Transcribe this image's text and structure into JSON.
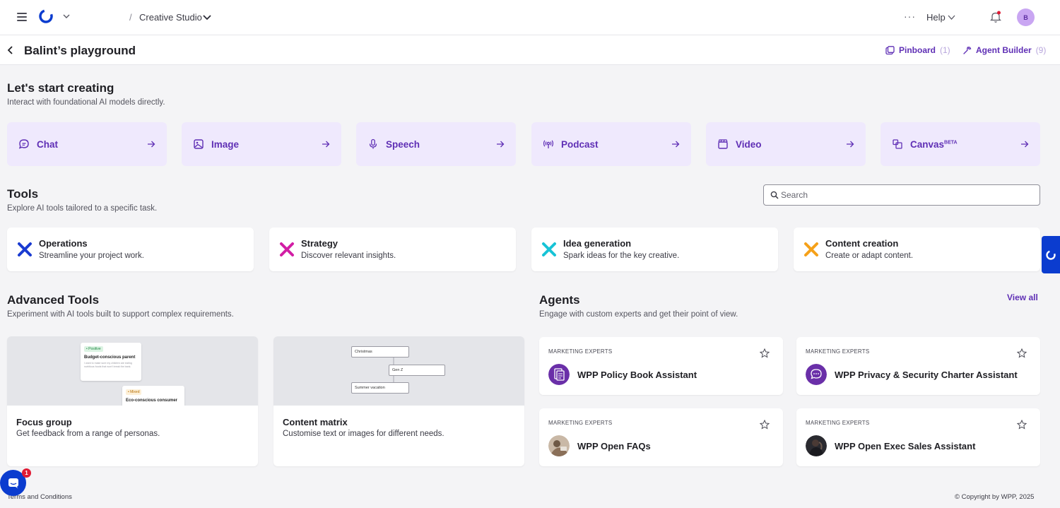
{
  "topnav": {
    "breadcrumb_separator": "/",
    "workspace": "Creative Studio",
    "more": "···",
    "help": "Help",
    "avatar_initial": "B"
  },
  "header": {
    "title": "Balint’s playground",
    "pinboard_label": "Pinboard",
    "pinboard_count": "(1)",
    "agent_builder_label": "Agent Builder",
    "agent_builder_count": "(9)"
  },
  "create": {
    "heading": "Let's start creating",
    "subheading": "Interact with foundational AI models directly.",
    "models": [
      {
        "label": "Chat",
        "icon": "chat-bubble-icon"
      },
      {
        "label": "Image",
        "icon": "image-icon"
      },
      {
        "label": "Speech",
        "icon": "microphone-icon"
      },
      {
        "label": "Podcast",
        "icon": "broadcast-icon"
      },
      {
        "label": "Video",
        "icon": "video-clapper-icon"
      },
      {
        "label": "Canvas",
        "badge": "BETA",
        "icon": "canvas-icon"
      }
    ]
  },
  "tools": {
    "heading": "Tools",
    "subheading": "Explore AI tools tailored to a specific task.",
    "search_placeholder": "Search",
    "items": [
      {
        "title": "Operations",
        "desc": "Streamline your project work.",
        "color": "#1a3bd1"
      },
      {
        "title": "Strategy",
        "desc": "Discover relevant insights.",
        "color": "#d21ea5"
      },
      {
        "title": "Idea generation",
        "desc": "Spark ideas for the key creative.",
        "color": "#17c3d6"
      },
      {
        "title": "Content creation",
        "desc": "Create or adapt content.",
        "color": "#f5a11a"
      }
    ]
  },
  "advanced": {
    "heading": "Advanced Tools",
    "subheading": "Experiment with AI tools built to support complex requirements.",
    "items": [
      {
        "title": "Focus group",
        "desc": "Get feedback from a range of personas.",
        "preview": {
          "card1_tag": "• Positive",
          "card1_title": "Budget-conscious parent",
          "card1_text": "I want to make sure my children are eating nutritious foods that won't break the bank.",
          "card2_tag": "• Mixed",
          "card2_title": "Eco-conscious consumer"
        }
      },
      {
        "title": "Content matrix",
        "desc": "Customise text or images for different needs.",
        "preview": {
          "box1": "Christmas",
          "box2": "Gen Z",
          "box3": "Summer vacation"
        }
      }
    ]
  },
  "agents": {
    "heading": "Agents",
    "subheading": "Engage with custom experts and get their point of view.",
    "view_all": "View all",
    "items": [
      {
        "category": "MARKETING EXPERTS",
        "name": "WPP Policy Book Assistant"
      },
      {
        "category": "MARKETING EXPERTS",
        "name": "WPP Privacy & Security Charter Assistant"
      },
      {
        "category": "MARKETING EXPERTS",
        "name": "WPP Open FAQs"
      },
      {
        "category": "MARKETING EXPERTS",
        "name": "WPP Open Exec Sales Assistant"
      }
    ]
  },
  "footer": {
    "terms": "Terms and Conditions",
    "copyright": "© Copyright by WPP, 2025",
    "chat_badge": "1"
  },
  "colors": {
    "accent": "#5f2fb5",
    "card_tint": "#efe9fd",
    "brand_blue": "#0b3ccf"
  }
}
